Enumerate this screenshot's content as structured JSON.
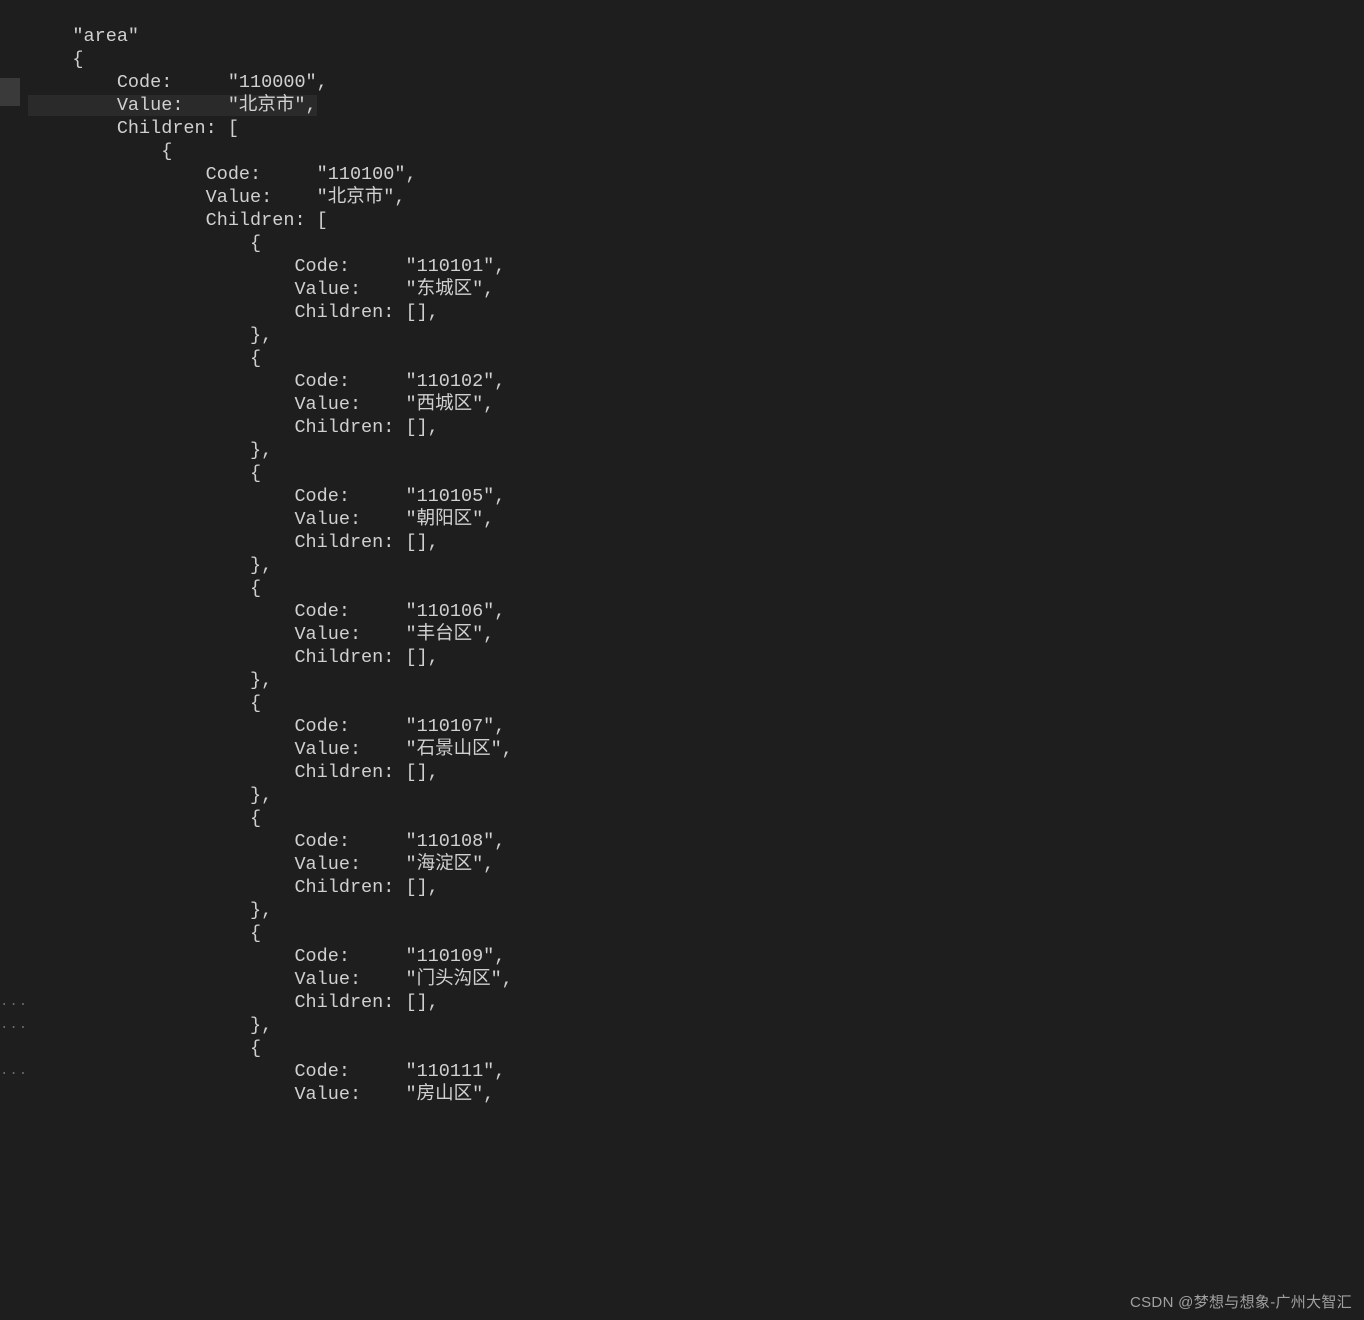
{
  "watermark": "CSDN @梦想与想象-广州大智汇",
  "code_lines": [
    "    \"area\"",
    "    {",
    "        Code:     \"110000\",",
    "        Value:    \"北京市\",",
    "        Children: [",
    "            {",
    "                Code:     \"110100\",",
    "                Value:    \"北京市\",",
    "                Children: [",
    "                    {",
    "                        Code:     \"110101\",",
    "                        Value:    \"东城区\",",
    "                        Children: [],",
    "                    },",
    "                    {",
    "                        Code:     \"110102\",",
    "                        Value:    \"西城区\",",
    "                        Children: [],",
    "                    },",
    "                    {",
    "                        Code:     \"110105\",",
    "                        Value:    \"朝阳区\",",
    "                        Children: [],",
    "                    },",
    "                    {",
    "                        Code:     \"110106\",",
    "                        Value:    \"丰台区\",",
    "                        Children: [],",
    "                    },",
    "                    {",
    "                        Code:     \"110107\",",
    "                        Value:    \"石景山区\",",
    "                        Children: [],",
    "                    },",
    "                    {",
    "                        Code:     \"110108\",",
    "                        Value:    \"海淀区\",",
    "                        Children: [],",
    "                    },",
    "                    {",
    "                        Code:     \"110109\",",
    "                        Value:    \"门头沟区\",",
    "                        Children: [],",
    "                    },",
    "                    {",
    "                        Code:     \"110111\",",
    "                        Value:    \"房山区\","
  ],
  "gutter_dots": [
    "...",
    "...",
    "..."
  ]
}
